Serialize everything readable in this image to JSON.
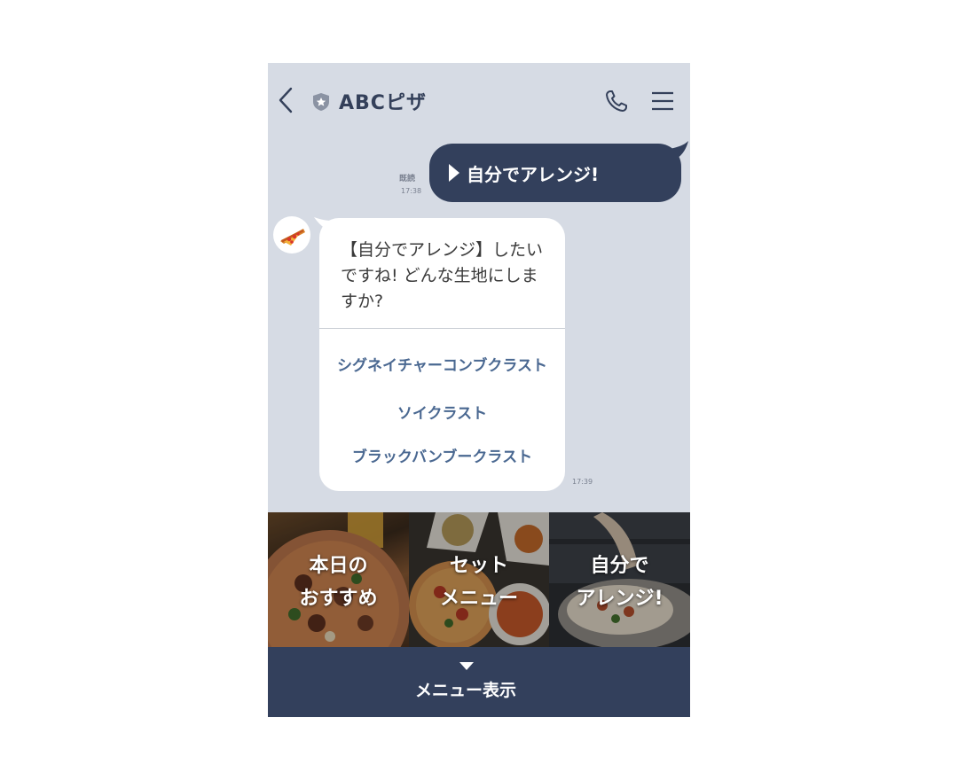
{
  "header": {
    "title": "ABCピザ",
    "back_icon": "chevron-left-icon",
    "badge_icon": "shield-star-icon",
    "call_icon": "phone-icon",
    "menu_icon": "hamburger-icon"
  },
  "messages": {
    "outgoing": {
      "text": "自分でアレンジ!",
      "read_label": "既読",
      "time": "17:38"
    },
    "incoming": {
      "avatar_icon": "pizza-icon",
      "text": "【自分でアレンジ】したいですね! どんな生地にしますか?",
      "options": [
        "シグネイチャーコンブクラスト",
        "ソイクラスト",
        "ブラックバンブークラスト"
      ],
      "time": "17:39"
    }
  },
  "rich_menu": {
    "tiles": [
      {
        "line1": "本日の",
        "line2": "おすすめ"
      },
      {
        "line1": "セット",
        "line2": "メニュー"
      },
      {
        "line1": "自分で",
        "line2": "アレンジ!"
      }
    ]
  },
  "bottom_bar": {
    "label": "メニュー表示",
    "icon": "caret-down-icon"
  },
  "colors": {
    "chat_bg": "#d6dbe4",
    "navy": "#33405c",
    "link_blue": "#4a6891"
  }
}
